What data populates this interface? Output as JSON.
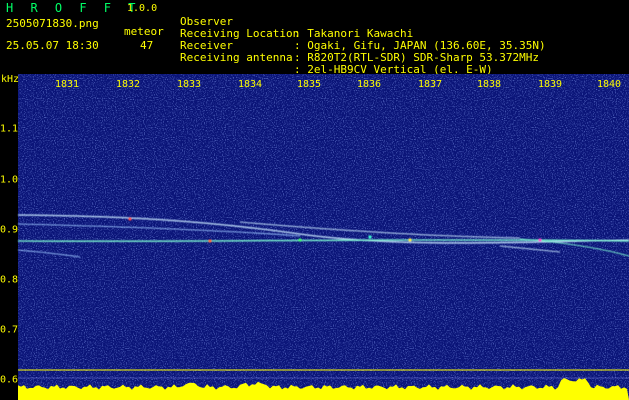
{
  "app": {
    "title": "H R O F F T",
    "version": "1.0.0"
  },
  "file": {
    "name": "2505071830.png",
    "datetime": "25.05.07 18:30"
  },
  "meteor": {
    "label": "meteor",
    "count": "47"
  },
  "info": [
    {
      "label": "Observer",
      "value": ": Takanori Kawachi"
    },
    {
      "label": "Receiving Location",
      "value": ": Ogaki, Gifu, JAPAN (136.60E, 35.35N)"
    },
    {
      "label": "Receiver",
      "value": ": R820T2(RTL-SDR) SDR-Sharp 53.372MHz"
    },
    {
      "label": "Receiving antenna",
      "value": ": 2el-HB9CV Vertical (el. E-W)"
    }
  ],
  "axis": {
    "unit": "kHz",
    "x_ticks": [
      "1831",
      "1832",
      "1833",
      "1834",
      "1835",
      "1836",
      "1837",
      "1838",
      "1839",
      "1840"
    ],
    "y_ticks": [
      "1.1",
      "1.0",
      "0.9",
      "0.8",
      "0.7",
      "0.6"
    ]
  },
  "colors": {
    "background": "#000000",
    "spectrogram": "#0a1478",
    "noise": "#3a52d8",
    "text": "#ffff00",
    "title": "#00ff66",
    "echo": "#c8e8ff",
    "baseline": "#ffff00"
  }
}
